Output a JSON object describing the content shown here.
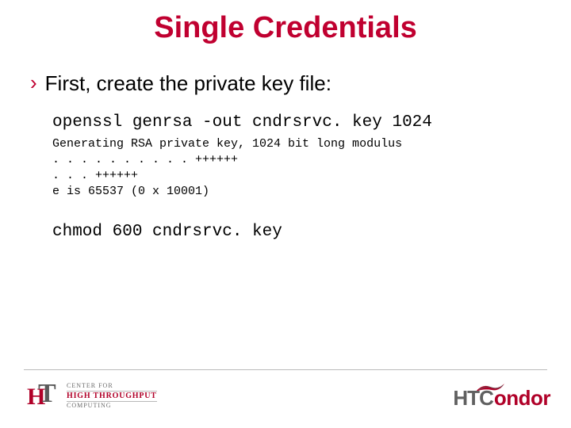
{
  "title": "Single Credentials",
  "bullet": {
    "marker": "›",
    "text": "First, create the private key file:"
  },
  "cmd1": "openssl genrsa -out cndrsrvc. key 1024",
  "output": "Generating RSA private key, 1024 bit long modulus\n. . . . . . . . . . ++++++\n. . . ++++++\ne is 65537 (0 x 10001)",
  "cmd2": "chmod 600 cndrsrvc. key",
  "logo_left": {
    "mark_h": "H",
    "mark_t": "T",
    "line1": "CENTER FOR",
    "line2": "HIGH THROUGHPUT",
    "line3": "COMPUTING"
  },
  "logo_right": {
    "part1": "HTC",
    "part2": "ondor"
  }
}
